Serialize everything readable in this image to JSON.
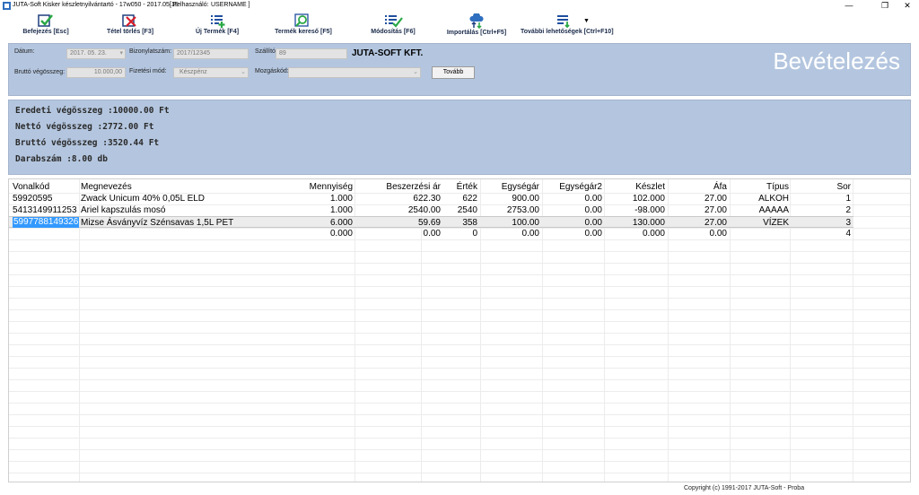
{
  "window": {
    "title": "JUTA-Soft Kisker készletnyilvántartó - 17w050 - 2017.05.15",
    "user_label": "[ Felhasználó:",
    "user_name": "USERNAME ]",
    "minimize": "—",
    "restore": "❐",
    "close": "✕"
  },
  "toolbar": {
    "finish": "Befejezés [Esc]",
    "delete_item": "Tétel törlés [F3]",
    "new_product": "Új Termék [F4]",
    "product_search": "Termék kereső [F5]",
    "modify": "Módosítás [F6]",
    "import": "Importálás [Ctrl+F5]",
    "more": "További lehetőségek [Ctrl+F10]",
    "more_dropdown": "▼"
  },
  "header": {
    "date_label": "Dátum:",
    "date_value": "2017. 05. 23.",
    "doc_number_label": "Bizonylatszám:",
    "doc_number_value": "2017/12345",
    "supplier_label": "Szállító:",
    "supplier_code": "89",
    "supplier_name": "JUTA-SOFT KFT.",
    "gross_total_label": "Bruttó végösszeg:",
    "gross_total_value": "10.000,00",
    "payment_label": "Fizetési mód:",
    "payment_value": "Készpénz",
    "movement_label": "Mozgáskód:",
    "movement_value": "",
    "next_button": "Tovább",
    "page_heading": "Bevételezés"
  },
  "summary": {
    "original_total": "Eredeti végösszeg :10000.00 Ft",
    "net_total": "Nettó végösszeg :2772.00 Ft",
    "gross_total": "Bruttó végösszeg :3520.44 Ft",
    "quantity": "Darabszám :8.00 db"
  },
  "grid": {
    "columns": [
      "Vonalkód",
      "Megnevezés",
      "Mennyiség",
      "Beszerzési ár",
      "Érték",
      "Egységár",
      "Egységár2",
      "Készlet",
      "Áfa",
      "Típus",
      "Sor"
    ],
    "rows": [
      [
        "59920595",
        "Zwack Unicum 40% 0,05L ELD",
        "1.000",
        "622.30",
        "622",
        "900.00",
        "0.00",
        "102.000",
        "27.00",
        "ALKOH",
        "1"
      ],
      [
        "5413149911253",
        "Ariel kapszulás mosó",
        "1.000",
        "2540.00",
        "2540",
        "2753.00",
        "0.00",
        "-98.000",
        "27.00",
        "AAAAA",
        "2"
      ],
      [
        "5997788149326",
        "Mizse Ásványvíz Szénsavas 1,5L PET",
        "6.000",
        "59.69",
        "358",
        "100.00",
        "0.00",
        "130.000",
        "27.00",
        "VÍZEK",
        "3"
      ],
      [
        "",
        "",
        "0.000",
        "0.00",
        "0",
        "0.00",
        "0.00",
        "0.000",
        "0.00",
        "",
        "4"
      ]
    ]
  },
  "footer": {
    "copyright": "Copyright (c) 1991-2017 JUTA-Soft -  Proba"
  },
  "colors": {
    "panel": "#b4c6df",
    "selection": "#3399ff",
    "heading": "#ffffff"
  },
  "icons": [
    "app-icon",
    "checkmark-icon",
    "delete-x-icon",
    "list-add-icon",
    "search-icon",
    "list-check-icon",
    "cloud-transfer-icon",
    "list-more-icon"
  ]
}
